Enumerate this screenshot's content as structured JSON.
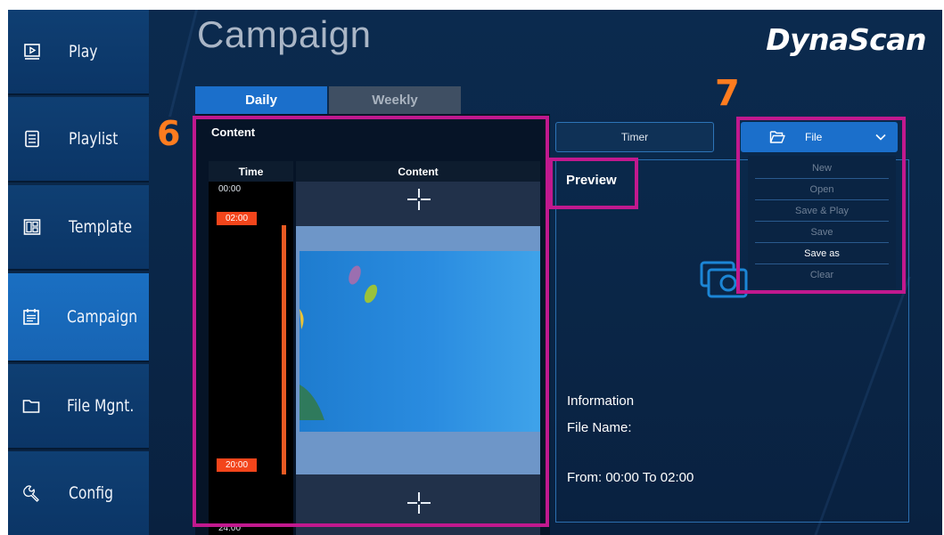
{
  "app": {
    "title": "Campaign",
    "brand": "DynaScan"
  },
  "sidebar": {
    "items": [
      {
        "label": "Play",
        "icon": "play-screen-icon",
        "active": false
      },
      {
        "label": "Playlist",
        "icon": "list-document-icon",
        "active": false
      },
      {
        "label": "Template",
        "icon": "layout-grid-icon",
        "active": false
      },
      {
        "label": "Campaign",
        "icon": "calendar-list-icon",
        "active": true
      },
      {
        "label": "File Mgnt.",
        "icon": "folder-icon",
        "active": false
      },
      {
        "label": "Config",
        "icon": "wrench-icon",
        "active": false
      }
    ]
  },
  "tabs": [
    {
      "label": "Daily",
      "selected": true
    },
    {
      "label": "Weekly",
      "selected": false
    }
  ],
  "content_panel": {
    "heading": "Content",
    "columns": {
      "time": "Time",
      "content": "Content"
    },
    "time_start": "00:00",
    "time_end": "24:00",
    "range_start": "02:00",
    "range_end": "20:00"
  },
  "toolbar": {
    "timer_label": "Timer",
    "file_label": "File"
  },
  "file_menu": {
    "items": [
      {
        "label": "New",
        "enabled": false
      },
      {
        "label": "Open",
        "enabled": false
      },
      {
        "label": "Save & Play",
        "enabled": false
      },
      {
        "label": "Save",
        "enabled": false
      },
      {
        "label": "Save as",
        "enabled": true
      },
      {
        "label": "Clear",
        "enabled": false
      }
    ]
  },
  "preview": {
    "label": "Preview",
    "info_heading": "Information",
    "file_name_label": "File Name:",
    "range_text": "From: 00:00 To 02:00"
  },
  "annotations": {
    "left_number": "6",
    "right_number": "7"
  },
  "colors": {
    "accent": "#1b6fcb",
    "time_badge": "#f3451b",
    "annotation_box": "#c1198e",
    "annotation_number": "#ff7c1f"
  }
}
